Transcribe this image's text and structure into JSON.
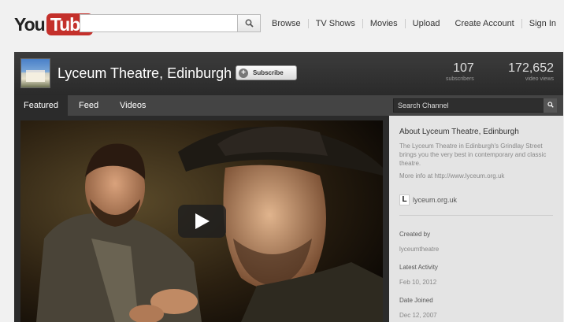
{
  "header": {
    "logo_you": "You",
    "logo_tube": "Tube",
    "search_placeholder": "",
    "nav": [
      "Browse",
      "TV Shows",
      "Movies",
      "Upload"
    ],
    "account": [
      "Create Account",
      "Sign In"
    ]
  },
  "channel": {
    "title": "Lyceum Theatre, Edinburgh",
    "subscribe_label": "Subscribe",
    "subscribers": {
      "value": "107",
      "label": "subscribers"
    },
    "views": {
      "value": "172,652",
      "label": "video views"
    },
    "tabs": [
      "Featured",
      "Feed",
      "Videos"
    ],
    "search_channel": "Search Channel"
  },
  "about": {
    "heading": "About Lyceum Theatre, Edinburgh",
    "description": "The Lyceum Theatre in Edinburgh's Grindlay Street brings you the very best in contemporary and classic theatre.",
    "more_info": "More info at http://www.lyceum.org.uk",
    "link_letter": "L",
    "link": "lyceum.org.uk",
    "created_by_label": "Created by",
    "created_by": "lyceumtheatre",
    "latest_activity_label": "Latest Activity",
    "latest_activity": "Feb 10, 2012",
    "date_joined_label": "Date Joined",
    "date_joined": "Dec 12, 2007"
  },
  "colors": {
    "brand_red": "#c4302b",
    "dark_bg": "#2b2b2b",
    "sidebar_bg": "#e4e4e4"
  }
}
